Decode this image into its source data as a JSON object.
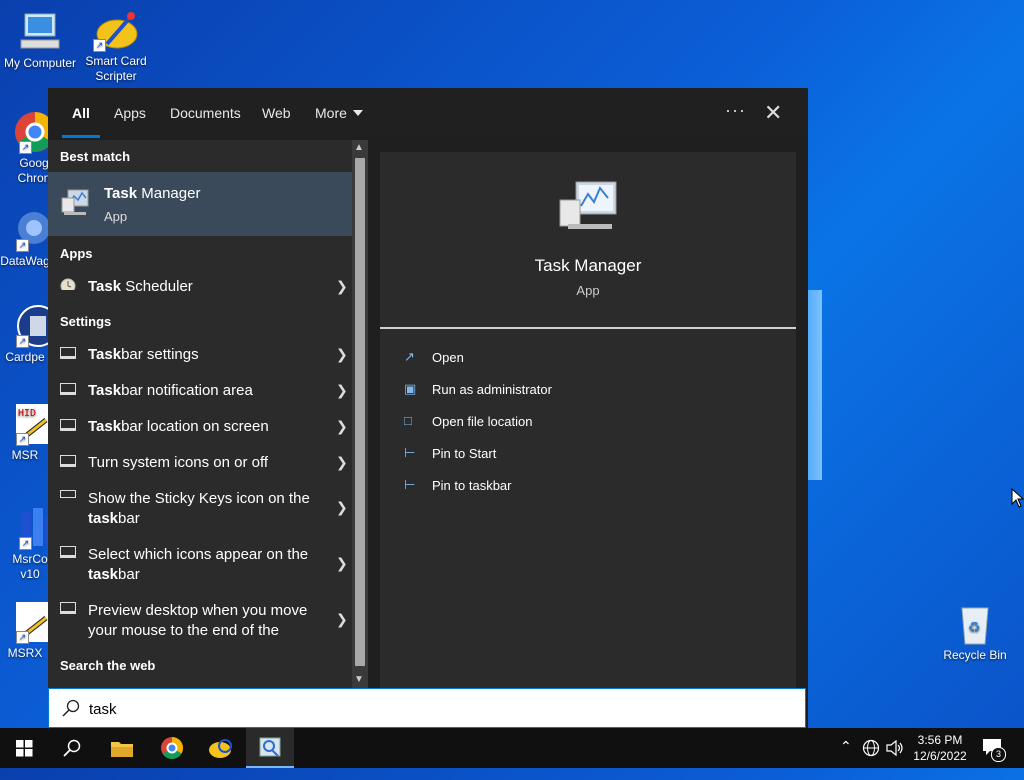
{
  "desktop": {
    "icons": [
      {
        "label": "My Computer"
      },
      {
        "label": "Smart Card Scripter"
      },
      {
        "label": "Goog Chron"
      },
      {
        "label": "DataWag"
      },
      {
        "label": "Cardpe"
      },
      {
        "label": "MSR"
      },
      {
        "label": "MsrCo v10"
      },
      {
        "label": "MSRX"
      },
      {
        "label": "Recycle Bin"
      }
    ]
  },
  "search_panel": {
    "tabs": [
      {
        "label": "All",
        "active": true
      },
      {
        "label": "Apps"
      },
      {
        "label": "Documents"
      },
      {
        "label": "Web"
      },
      {
        "label": "More"
      }
    ],
    "more_options": "···",
    "close": "✕",
    "best_match_heading": "Best match",
    "best_match": {
      "title_bold": "Task",
      "title_rest": " Manager",
      "subtitle": "App"
    },
    "apps_heading": "Apps",
    "apps": [
      {
        "bold": "Task",
        "rest": " Scheduler"
      }
    ],
    "settings_heading": "Settings",
    "settings": [
      {
        "bold": "Task",
        "rest": "bar settings"
      },
      {
        "bold": "Task",
        "rest": "bar notification area"
      },
      {
        "bold": "Task",
        "rest": "bar location on screen"
      },
      {
        "bold": "",
        "rest": "Turn system icons on or off"
      },
      {
        "line1": "Show the Sticky Keys icon on the",
        "bold": "task",
        "rest": "bar"
      },
      {
        "line1": "Select which icons appear on the",
        "bold": "task",
        "rest": "bar"
      },
      {
        "line1": "Preview desktop when you move",
        "line2": "your mouse to the end of the"
      }
    ],
    "web_heading": "Search the web",
    "detail": {
      "name": "Task Manager",
      "type": "App",
      "actions": [
        {
          "label": "Open",
          "icon": "open-icon"
        },
        {
          "label": "Run as administrator",
          "icon": "shield-icon"
        },
        {
          "label": "Open file location",
          "icon": "file-icon"
        },
        {
          "label": "Pin to Start",
          "icon": "pin-icon"
        },
        {
          "label": "Pin to taskbar",
          "icon": "pin-icon"
        }
      ]
    },
    "search_value": "task"
  },
  "taskbar": {
    "time": "3:56 PM",
    "date": "12/6/2022",
    "notifications": "3"
  },
  "colors": {
    "accent": "#0078d7",
    "panel": "#1f1f1f",
    "highlight": "#3b4a5a"
  }
}
